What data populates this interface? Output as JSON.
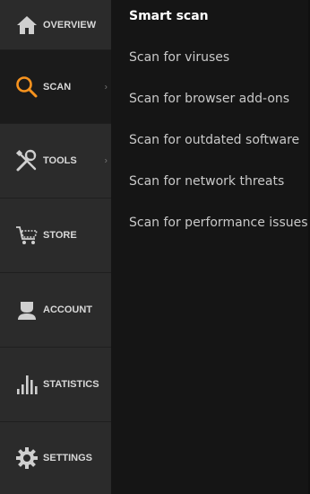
{
  "sidebar": {
    "items": [
      {
        "label": "OVERVIEW",
        "icon": "home-icon",
        "active": false,
        "has_submenu": false
      },
      {
        "label": "SCAN",
        "icon": "magnifier-icon",
        "active": true,
        "has_submenu": true
      },
      {
        "label": "TOOLS",
        "icon": "tools-icon",
        "active": false,
        "has_submenu": true
      },
      {
        "label": "STORE",
        "icon": "cart-icon",
        "active": false,
        "has_submenu": false
      },
      {
        "label": "ACCOUNT",
        "icon": "user-icon",
        "active": false,
        "has_submenu": false
      },
      {
        "label": "STATISTICS",
        "icon": "bars-icon",
        "active": false,
        "has_submenu": false
      },
      {
        "label": "SETTINGS",
        "icon": "gear-icon",
        "active": false,
        "has_submenu": false
      }
    ],
    "chevron": "›"
  },
  "scan_menu": {
    "title": "Smart scan",
    "items": [
      "Scan for viruses",
      "Scan for browser add-ons",
      "Scan for outdated software",
      "Scan for network threats",
      "Scan for performance issues"
    ]
  },
  "colors": {
    "accent": "#f7931e",
    "sidebar_bg": "#2b2b2b",
    "active_bg": "#1b1b1b",
    "panel_bg": "#151515"
  }
}
